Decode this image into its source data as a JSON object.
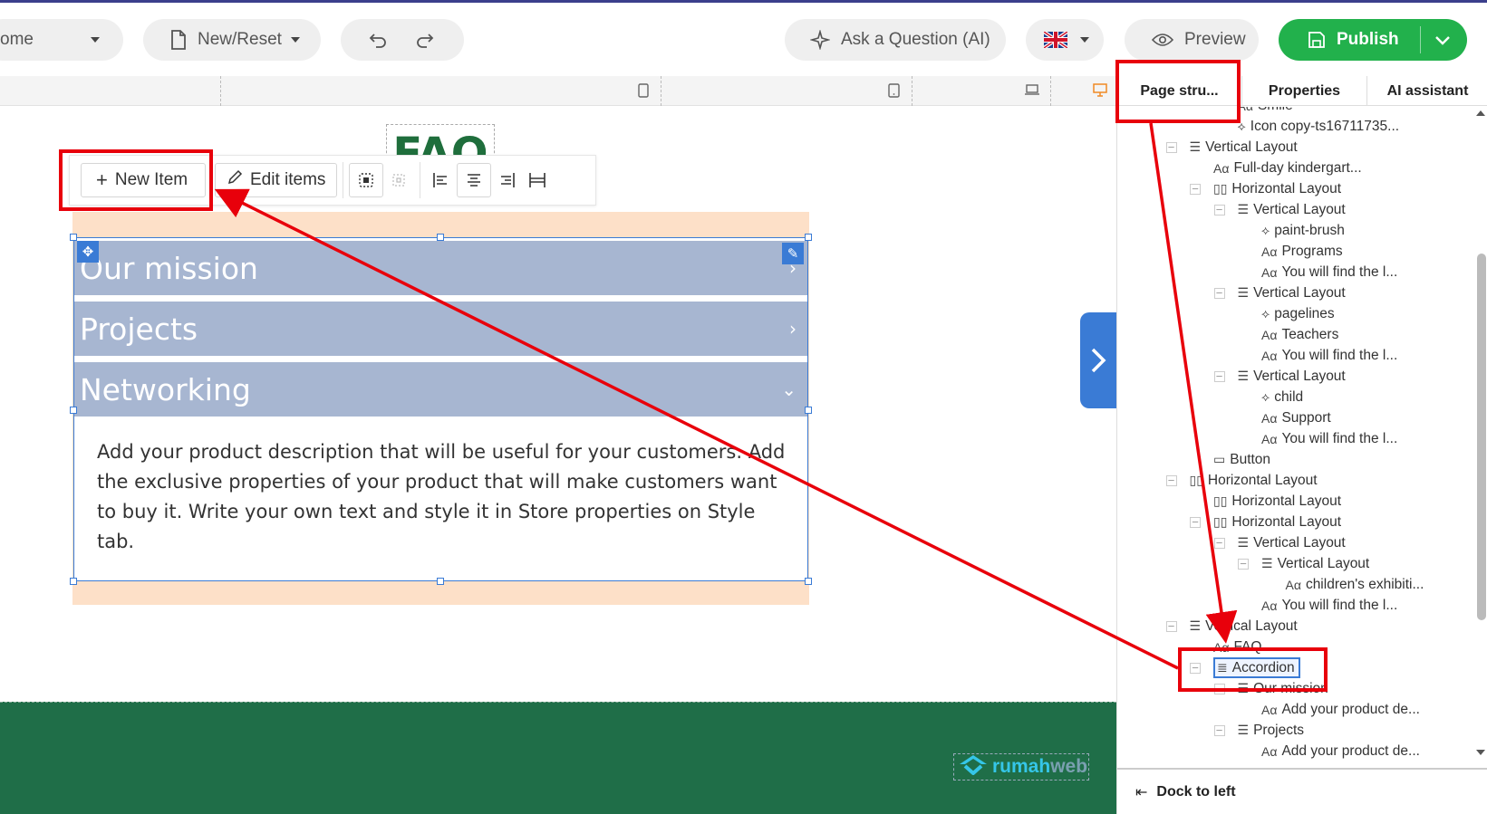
{
  "toolbar": {
    "home_label": "ome",
    "new_reset_label": "New/Reset",
    "ask_label": "Ask a Question (AI)",
    "preview_label": "Preview",
    "publish_label": "Publish",
    "language_icon": "uk-flag-icon"
  },
  "canvas": {
    "faq_title": "FAQ",
    "new_item_label": "New Item",
    "edit_items_label": "Edit items",
    "accordion": {
      "items": [
        {
          "label": "Our mission"
        },
        {
          "label": "Projects"
        },
        {
          "label": "Networking"
        }
      ],
      "body": "Add your product description that will be useful for your customers. Add the exclusive properties of your product that will make customers want to buy it. Write your own text and style it in Store properties on Style tab."
    },
    "logo_text_1": "rumah",
    "logo_text_2": "web"
  },
  "panel": {
    "tabs": [
      "Page stru...",
      "Properties",
      "AI assistant"
    ],
    "tree": [
      {
        "label": "Smile",
        "type": "text"
      },
      {
        "label": "Icon copy-ts16711735...",
        "type": "icon"
      },
      {
        "label": "Vertical Layout",
        "type": "vlayout"
      },
      {
        "label": "Full-day kindergart...",
        "type": "text"
      },
      {
        "label": "Horizontal Layout",
        "type": "hlayout"
      },
      {
        "label": "Vertical Layout",
        "type": "vlayout"
      },
      {
        "label": "paint-brush",
        "type": "icon"
      },
      {
        "label": "Programs",
        "type": "text"
      },
      {
        "label": "You will find the l...",
        "type": "text"
      },
      {
        "label": "Vertical Layout",
        "type": "vlayout"
      },
      {
        "label": "pagelines",
        "type": "icon"
      },
      {
        "label": "Teachers",
        "type": "text"
      },
      {
        "label": "You will find the l...",
        "type": "text"
      },
      {
        "label": "Vertical Layout",
        "type": "vlayout"
      },
      {
        "label": "child",
        "type": "icon"
      },
      {
        "label": "Support",
        "type": "text"
      },
      {
        "label": "You will find the l...",
        "type": "text"
      },
      {
        "label": "Button",
        "type": "button"
      },
      {
        "label": "Horizontal Layout",
        "type": "hlayout"
      },
      {
        "label": "Horizontal Layout",
        "type": "hlayout"
      },
      {
        "label": "Horizontal Layout",
        "type": "hlayout"
      },
      {
        "label": "Vertical Layout",
        "type": "vlayout"
      },
      {
        "label": "Vertical Layout",
        "type": "vlayout"
      },
      {
        "label": "children's exhibiti...",
        "type": "text"
      },
      {
        "label": "You will find the l...",
        "type": "text"
      },
      {
        "label": "Vertical Layout",
        "type": "vlayout"
      },
      {
        "label": "FAQ",
        "type": "text"
      },
      {
        "label": "Accordion",
        "type": "accordion"
      },
      {
        "label": "Our mission",
        "type": "vlayout"
      },
      {
        "label": "Add your product de...",
        "type": "text"
      },
      {
        "label": "Projects",
        "type": "vlayout"
      },
      {
        "label": "Add your product de...",
        "type": "text"
      }
    ],
    "dock_label": "Dock to left"
  },
  "colors": {
    "publish": "#22b14c",
    "accordion_header": "#a7b6d1",
    "footer": "#1f6e48",
    "annotation": "#e8000b",
    "selection": "#3a7bd5"
  }
}
